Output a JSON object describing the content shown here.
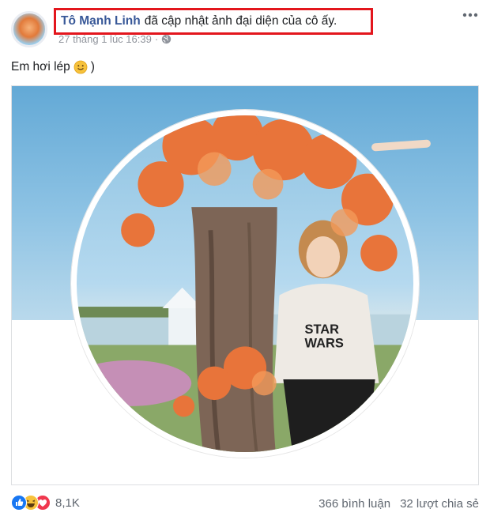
{
  "author": {
    "name": "Tô Mạnh Linh",
    "action": "đã cập nhật ảnh đại diện của cô ấy."
  },
  "meta": {
    "timestamp": "27 tháng 1 lúc 16:39",
    "privacy_icon": "globe-icon"
  },
  "caption": {
    "text": "Em hơi lép",
    "emoji": "slightly-smiling-face",
    "suffix": ")"
  },
  "photo": {
    "description_icon": "profile-photo"
  },
  "footer": {
    "reactions": [
      "like-icon",
      "haha-icon",
      "love-icon"
    ],
    "reaction_count": "8,1K",
    "comments": "366 bình luận",
    "shares": "32 lượt chia sẻ"
  },
  "colors": {
    "name": "#385898",
    "highlight": "#e3161d",
    "meta": "#90949c"
  }
}
